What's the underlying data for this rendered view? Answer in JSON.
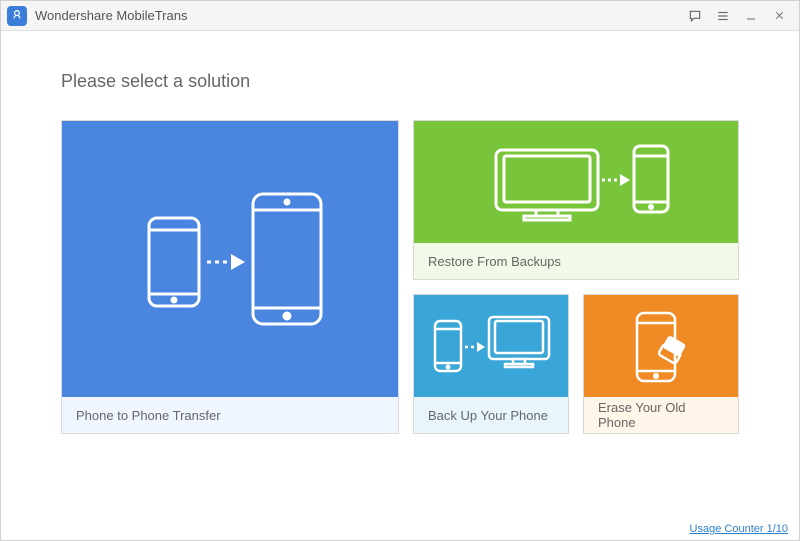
{
  "window": {
    "title": "Wondershare MobileTrans"
  },
  "heading": "Please select a solution",
  "tiles": {
    "transfer": {
      "label": "Phone to Phone Transfer"
    },
    "restore": {
      "label": "Restore From Backups"
    },
    "backup": {
      "label": "Back Up Your Phone"
    },
    "erase": {
      "label": "Erase Your Old Phone"
    }
  },
  "footer": {
    "usage_link": "Usage Counter 1/10"
  }
}
